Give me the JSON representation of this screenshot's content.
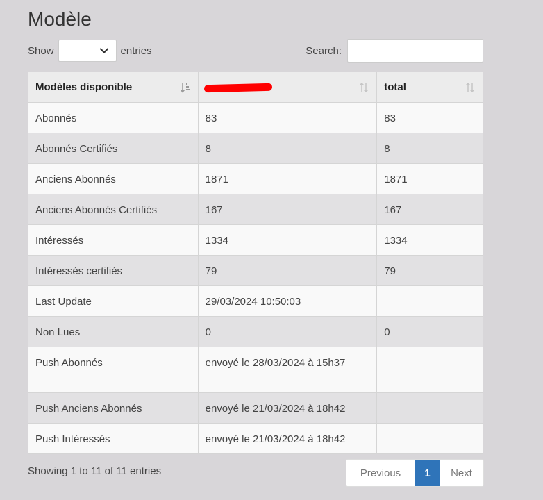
{
  "page": {
    "title": "Modèle"
  },
  "length_control": {
    "show_label": "Show",
    "selected_value": "",
    "entries_label": "entries"
  },
  "search": {
    "label": "Search:",
    "value": "",
    "placeholder": ""
  },
  "table": {
    "headers": [
      {
        "label": "Modèles disponible",
        "sort_state": "ascending"
      },
      {
        "label": "",
        "sort_state": "none",
        "redacted": true
      },
      {
        "label": "total",
        "sort_state": "none"
      }
    ],
    "rows": [
      [
        "Abonnés",
        "83",
        "83"
      ],
      [
        "Abonnés Certifiés",
        "8",
        "8"
      ],
      [
        "Anciens Abonnés",
        "1871",
        "1871"
      ],
      [
        "Anciens Abonnés Certifiés",
        "167",
        "167"
      ],
      [
        "Intéressés",
        "1334",
        "1334"
      ],
      [
        "Intéressés certifiés",
        "79",
        "79"
      ],
      [
        "Last Update",
        "29/03/2024 10:50:03",
        ""
      ],
      [
        "Non Lues",
        "0",
        "0"
      ],
      [
        "Push Abonnés",
        "envoyé le 28/03/2024 à 15h37",
        ""
      ],
      [
        "Push Anciens Abonnés",
        "envoyé le 21/03/2024 à 18h42",
        ""
      ],
      [
        "Push Intéressés",
        "envoyé le 21/03/2024 à 18h42",
        ""
      ]
    ]
  },
  "info_text": "Showing 1 to 11 of 11 entries",
  "pagination": {
    "previous_label": "Previous",
    "current_page": "1",
    "next_label": "Next"
  },
  "colors": {
    "background": "#d8d6d9",
    "active_page": "#2f74b9",
    "redaction": "#ff0000"
  }
}
